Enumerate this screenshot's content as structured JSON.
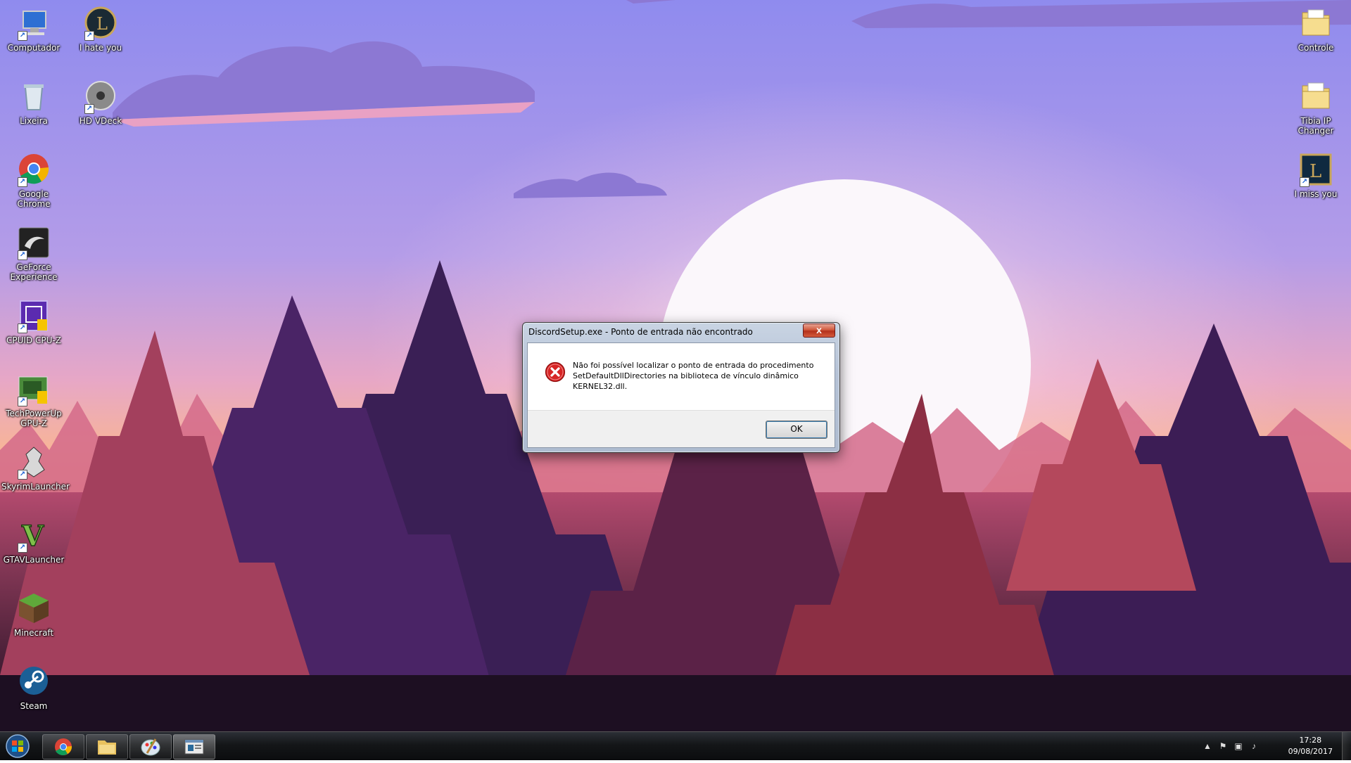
{
  "desktop": {
    "icons_left": [
      {
        "label": "Computador",
        "icon": "computer-icon"
      },
      {
        "label": "I hate you",
        "icon": "league-of-legends-icon"
      },
      {
        "label": "Lixeira",
        "icon": "recycle-bin-icon"
      },
      {
        "label": "HD VDeck",
        "icon": "hd-vdeck-icon"
      },
      {
        "label": "Google Chrome",
        "icon": "chrome-icon"
      },
      {
        "label": "GeForce Experience",
        "icon": "geforce-icon"
      },
      {
        "label": "CPUID CPU-Z",
        "icon": "cpuz-icon"
      },
      {
        "label": "TechPowerUp GPU-Z",
        "icon": "gpuz-icon"
      },
      {
        "label": "SkyrimLauncher",
        "icon": "skyrim-icon"
      },
      {
        "label": "GTAVLauncher",
        "icon": "gtav-icon"
      },
      {
        "label": "Minecraft",
        "icon": "minecraft-icon"
      },
      {
        "label": "Steam",
        "icon": "steam-icon"
      }
    ],
    "icons_right": [
      {
        "label": "Controle",
        "icon": "folder-icon"
      },
      {
        "label": "Tibia IP Changer",
        "icon": "folder-icon"
      },
      {
        "label": "I miss you",
        "icon": "league-of-legends-icon"
      }
    ]
  },
  "dialog": {
    "title": "DiscordSetup.exe - Ponto de entrada não encontrado",
    "close_label": "x",
    "message_line1": "Não foi possível localizar o ponto de entrada do procedimento",
    "message_line2": "SetDefaultDllDirectories na biblioteca de vínculo dinâmico",
    "message_line3": "KERNEL32.dll.",
    "ok_label": "OK",
    "icon": "error-icon"
  },
  "taskbar": {
    "pinned": [
      {
        "name": "chrome-icon"
      },
      {
        "name": "file-explorer-icon"
      },
      {
        "name": "paint-icon"
      },
      {
        "name": "discord-setup-icon"
      }
    ],
    "clock_time": "17:28",
    "clock_date": "09/08/2017"
  }
}
